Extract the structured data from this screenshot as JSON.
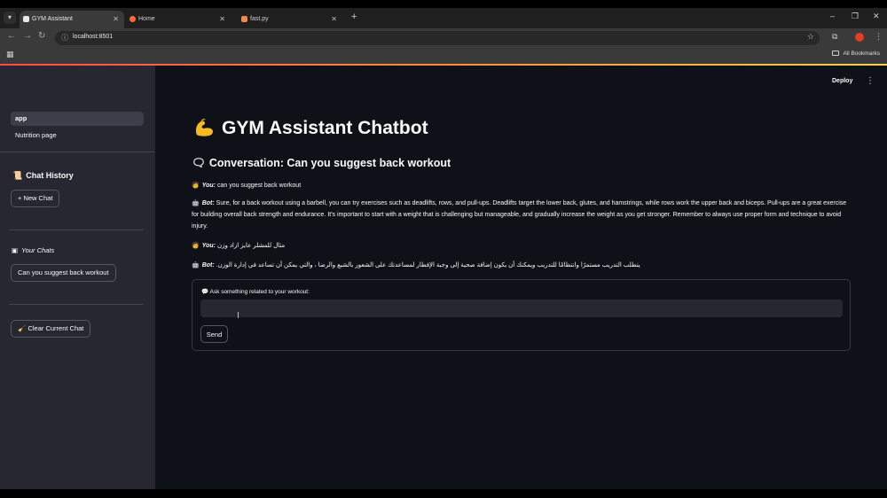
{
  "browser": {
    "tabs": [
      {
        "title": "GYM Assistant",
        "active": true,
        "favicon_color": "#e8e8e8"
      },
      {
        "title": "Home",
        "active": false,
        "favicon_color": "#ff6a3c"
      },
      {
        "title": "fast.py",
        "active": false,
        "favicon_color": "#f0884d"
      }
    ],
    "url": "localhost:8501",
    "bookmarks_label": "All Bookmarks",
    "profile_color": "#e53d21"
  },
  "sidebar": {
    "nav": [
      {
        "label": "app",
        "active": true
      },
      {
        "label": "Nutrition page",
        "active": false
      }
    ],
    "chat_history_heading": "Chat History",
    "new_chat_label": "New Chat",
    "your_chats_heading": "Your Chats",
    "chats": [
      "Can you suggest back workout"
    ],
    "clear_chat_label": "Clear Current Chat"
  },
  "main": {
    "deploy_label": "Deploy",
    "title": "GYM Assistant Chatbot",
    "conversation_title": "Conversation: Can you suggest back workout",
    "messages": [
      {
        "role": "You:",
        "text": "can you suggest back workout",
        "rtl": false
      },
      {
        "role": "Bot:",
        "text": "Sure, for a back workout using a barbell, you can try exercises such as deadlifts, rows, and pull-ups. Deadlifts target the lower back, glutes, and hamstrings, while rows work the upper back and biceps. Pull-ups are a great exercise for building overall back strength and endurance. It's important to start with a weight that is challenging but manageable, and gradually increase the weight as you get stronger. Remember to always use proper form and technique to avoid injury.",
        "rtl": false
      },
      {
        "role": "You:",
        "text": "مثال للمشلر عايز ازاد وزن",
        "rtl": true
      },
      {
        "role": "Bot:",
        "text": "يتطلب التدريب مستمرًا وانتظامًا للتدريب ويمكنك أن يكون إضافة صحية إلى وجبة الإفطار لمساعدتك على الشعور بالشبع والرضا ، والتي يمكن أن تساعد في إدارة الوزن.",
        "rtl": true
      }
    ],
    "form": {
      "label": "Ask something related to your workout:",
      "input_value": "",
      "send_label": "Send"
    }
  },
  "colors": {
    "app_bg": "#0e1117",
    "sidebar_bg": "#262730",
    "text": "#fafafa"
  }
}
